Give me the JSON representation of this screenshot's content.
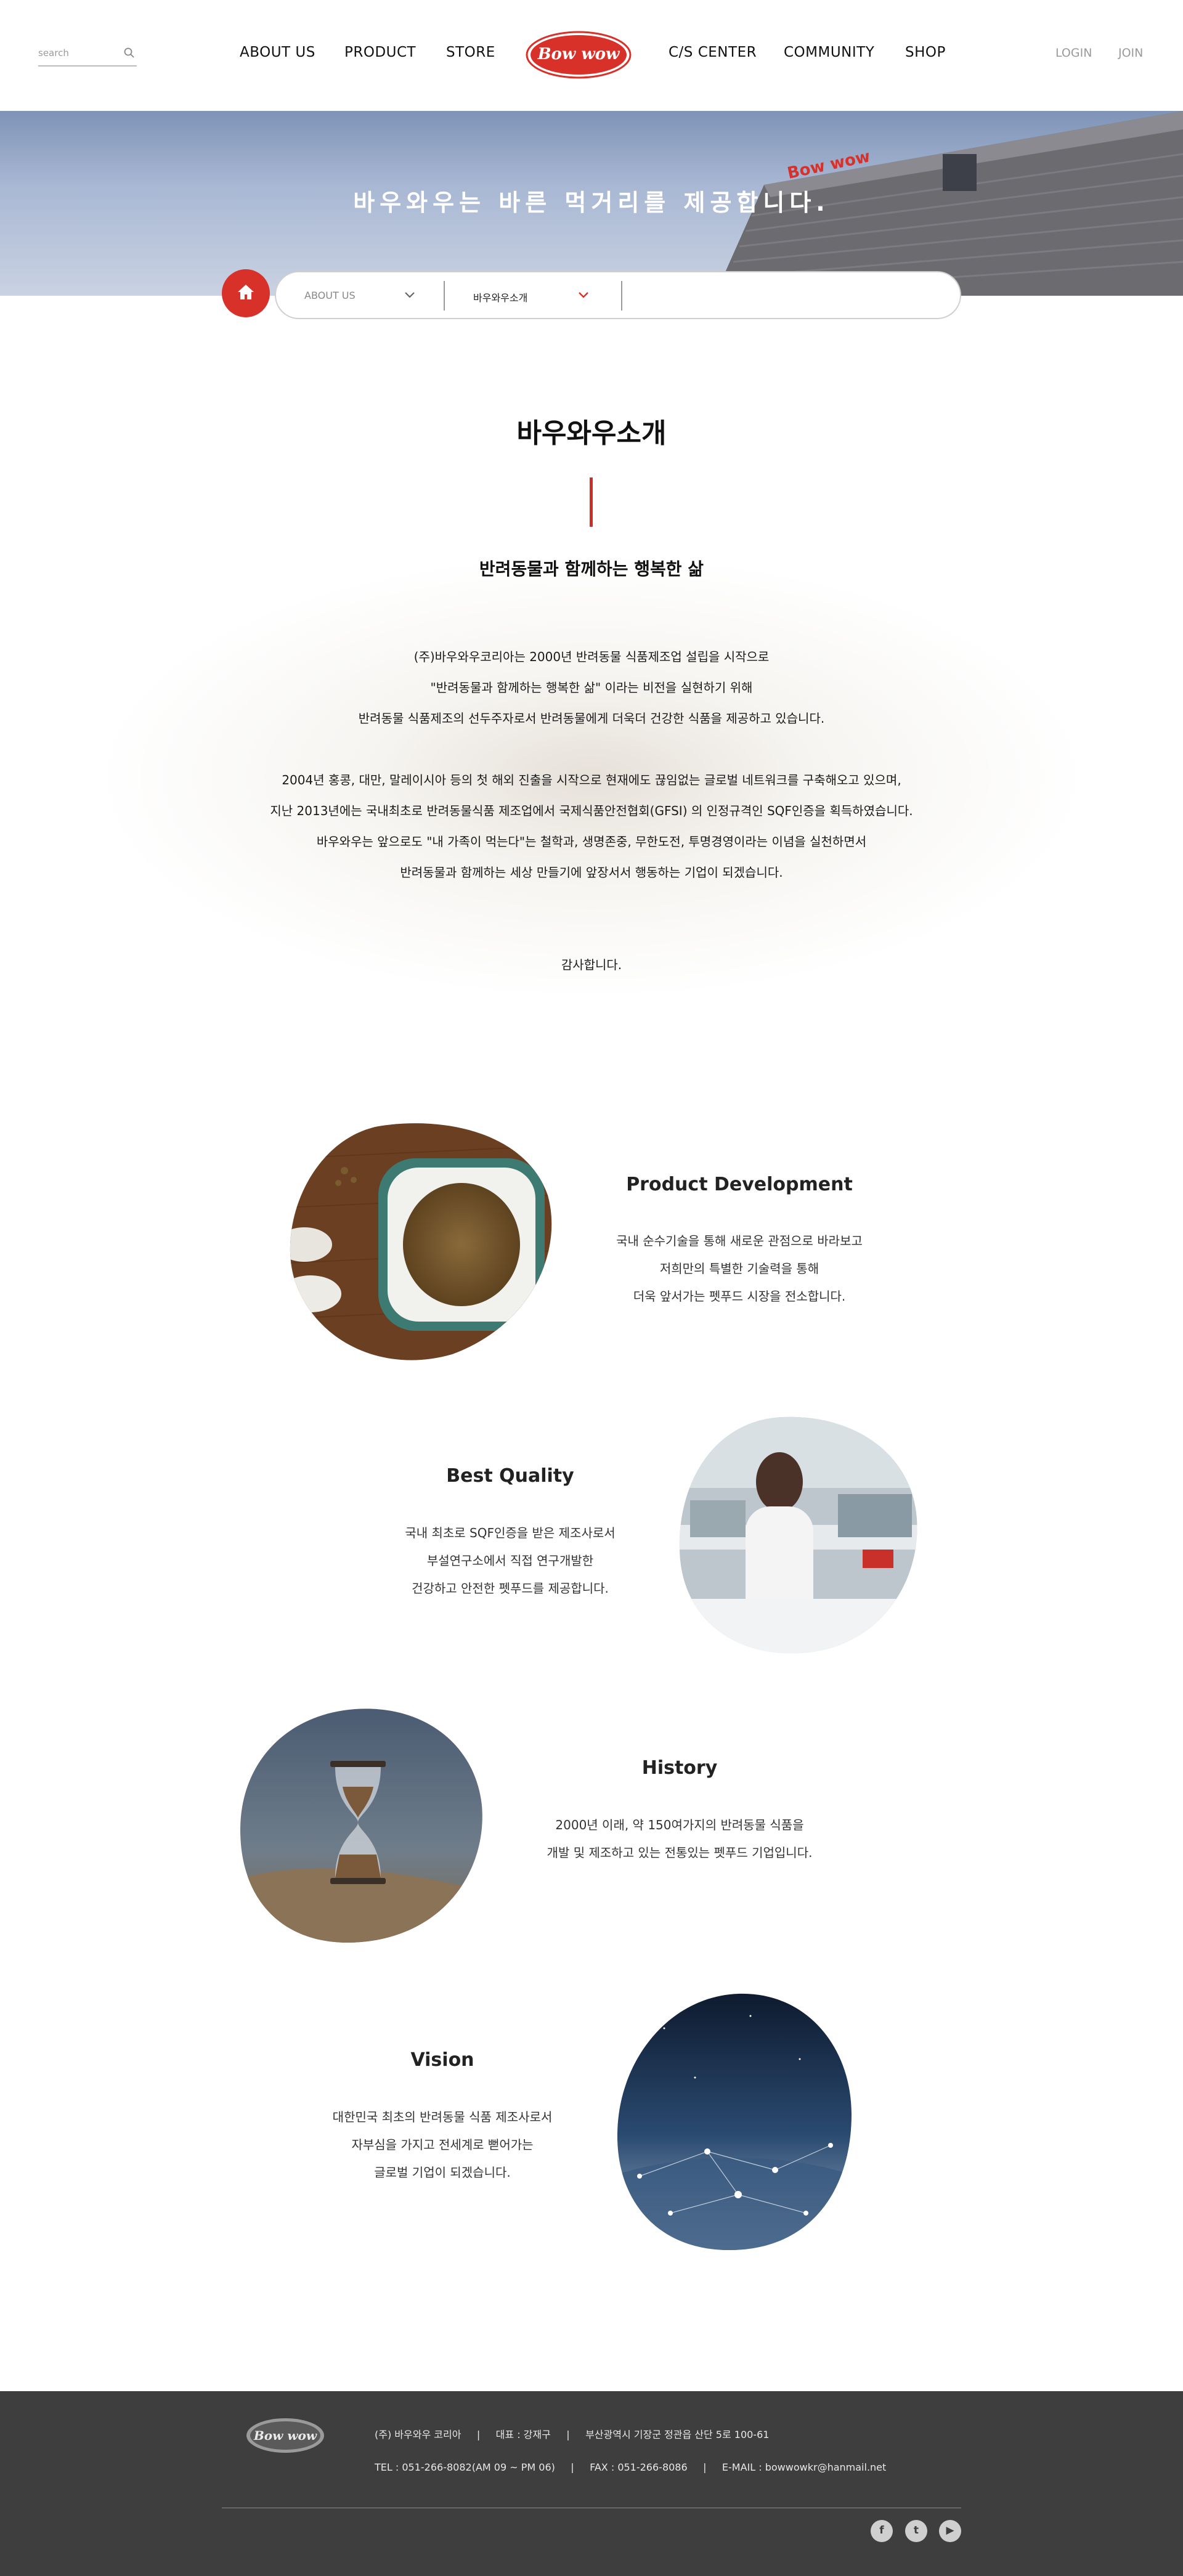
{
  "header": {
    "search_placeholder": "search",
    "nav": [
      "ABOUT US",
      "PRODUCT",
      "STORE",
      "C/S CENTER",
      "COMMUNITY",
      "SHOP"
    ],
    "logo_text": "Bow wow",
    "login": "LOGIN",
    "join": "JOIN"
  },
  "hero": {
    "title": "바우와우는 바른 먹거리를 제공합니다."
  },
  "subnav": {
    "item1": "ABOUT US",
    "item2": "바우와우소개"
  },
  "intro": {
    "title": "바우와우소개",
    "subtitle": "반려동물과 함께하는 행복한 삶",
    "lines": [
      "(주)바우와우코리아는 2000년 반려동물 식품제조업 설립을 시작으로",
      "\"반려동물과 함께하는 행복한 삶\" 이라는 비전을 실현하기 위해",
      "반려동물 식품제조의 선두주자로서 반려동물에게 더욱더 건강한 식품을 제공하고 있습니다.",
      "2004년 홍콩, 대만, 말레이시아 등의 첫 해외 진출을 시작으로 현재에도 끊임없는 글로벌 네트워크를 구축해오고 있으며,",
      "지난 2013년에는 국내최초로 반려동물식품 제조업에서 국제식품안전협회(GFSI) 의 인정규격인 SQF인증을 획득하였습니다.",
      "바우와우는 앞으로도 \"내 가족이 먹는다\"는 철학과, 생명존중, 무한도전, 투명경영이라는 이념을 실천하면서",
      "반려동물과 함께하는 세상 만들기에 앞장서서 행동하는 기업이 되겠습니다."
    ],
    "thanks": "감사합니다."
  },
  "features": [
    {
      "title": "Product Development",
      "lines": [
        "국내 순수기술을 통해 새로운 관점으로 바라보고",
        "저희만의 특별한 기술력을 통해",
        "더욱 앞서가는 펫푸드 시장을 전소합니다."
      ]
    },
    {
      "title": "Best Quality",
      "lines": [
        "국내 최초로 SQF인증을 받은 제조사로서",
        "부설연구소에서 직접 연구개발한",
        "건강하고 안전한 펫푸드를 제공합니다."
      ]
    },
    {
      "title": "History",
      "lines": [
        "2000년 이래, 약 150여가지의 반려동물 식품을",
        "개발 및 제조하고 있는 전통있는 펫푸드 기업입니다."
      ]
    },
    {
      "title": "Vision",
      "lines": [
        "대한민국 최초의 반려동물 식품 제조사로서",
        "자부심을 가지고 전세계로 뻗어가는",
        "글로벌 기업이 되겠습니다."
      ]
    }
  ],
  "footer": {
    "logo_text": "Bow wow",
    "row1": "(주) 바우와우 코리아     |     대표 : 강재구     |     부산광역시 기장군 정관읍 산단 5로 100-61",
    "row2": "TEL : 051-266-8082(AM 09 ~ PM 06)     |     FAX : 051-266-8086     |     E-MAIL : bowwowkr@hanmail.net",
    "social": [
      "f",
      "t",
      "▶"
    ]
  },
  "colors": {
    "accent": "#d8312a",
    "footer_bg": "#3e3e3e"
  }
}
